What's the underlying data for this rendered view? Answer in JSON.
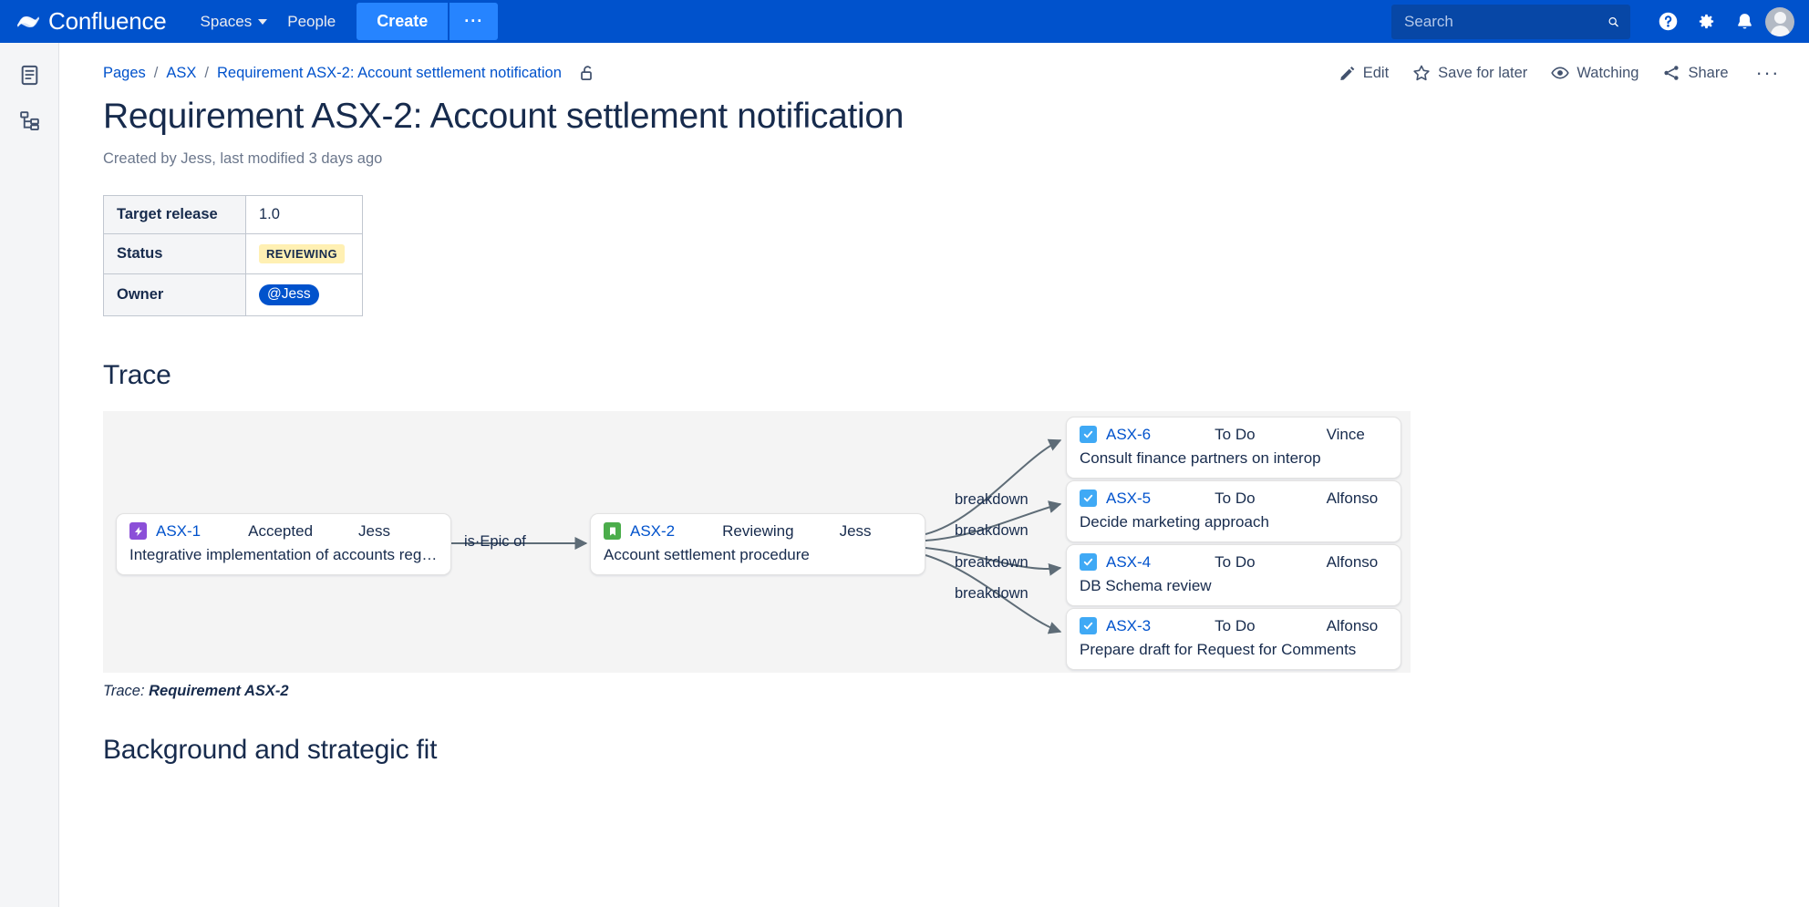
{
  "topnav": {
    "brand": "Confluence",
    "spaces": "Spaces",
    "people": "People",
    "create": "Create",
    "create_more": "···",
    "search_placeholder": "Search",
    "search_value": "",
    "accent_color": "#0052CC",
    "create_color": "#2684FF"
  },
  "breadcrumb": {
    "pages": "Pages",
    "space": "ASX",
    "current": "Requirement ASX-2: Account settlement notification",
    "sep": "/"
  },
  "page_actions": {
    "edit": "Edit",
    "save_for_later": "Save for later",
    "watching": "Watching",
    "share": "Share",
    "more": "···"
  },
  "page": {
    "title": "Requirement ASX-2: Account settlement notification",
    "byline": "Created by Jess, last modified 3 days ago"
  },
  "info_table": {
    "rows": [
      {
        "key": "Target release",
        "value": "1.0",
        "kind": "text"
      },
      {
        "key": "Status",
        "value": "REVIEWING",
        "kind": "lozenge",
        "color": "#FFF0B3"
      },
      {
        "key": "Owner",
        "value": "@Jess",
        "kind": "mention",
        "color": "#0052CC"
      }
    ]
  },
  "trace": {
    "heading": "Trace",
    "caption_prefix": "Trace: ",
    "caption_target": "Requirement ASX-2",
    "edge_label": "breakdown",
    "epic_link_label": "is·Epic of",
    "nodes": {
      "epic": {
        "key": "ASX-1",
        "status": "Accepted",
        "assignee": "Jess",
        "summary": "Integrative implementation of accounts rega...",
        "type": "epic",
        "type_color": "#8B4FD8"
      },
      "story": {
        "key": "ASX-2",
        "status": "Reviewing",
        "assignee": "Jess",
        "summary": "Account settlement procedure",
        "type": "story",
        "type_color": "#4BAD4B"
      },
      "tasks": [
        {
          "key": "ASX-6",
          "status": "To Do",
          "assignee": "Vince",
          "summary": "Consult finance partners on interop",
          "type": "task",
          "type_color": "#3FA9F5"
        },
        {
          "key": "ASX-5",
          "status": "To Do",
          "assignee": "Alfonso",
          "summary": "Decide marketing approach",
          "type": "task",
          "type_color": "#3FA9F5"
        },
        {
          "key": "ASX-4",
          "status": "To Do",
          "assignee": "Alfonso",
          "summary": "DB Schema review",
          "type": "task",
          "type_color": "#3FA9F5"
        },
        {
          "key": "ASX-3",
          "status": "To Do",
          "assignee": "Alfonso",
          "summary": "Prepare draft for Request for Comments",
          "type": "task",
          "type_color": "#3FA9F5"
        }
      ]
    },
    "edge_labels": [
      "breakdown",
      "breakdown",
      "breakdown",
      "breakdown"
    ]
  },
  "next_section": {
    "heading": "Background and strategic fit"
  }
}
